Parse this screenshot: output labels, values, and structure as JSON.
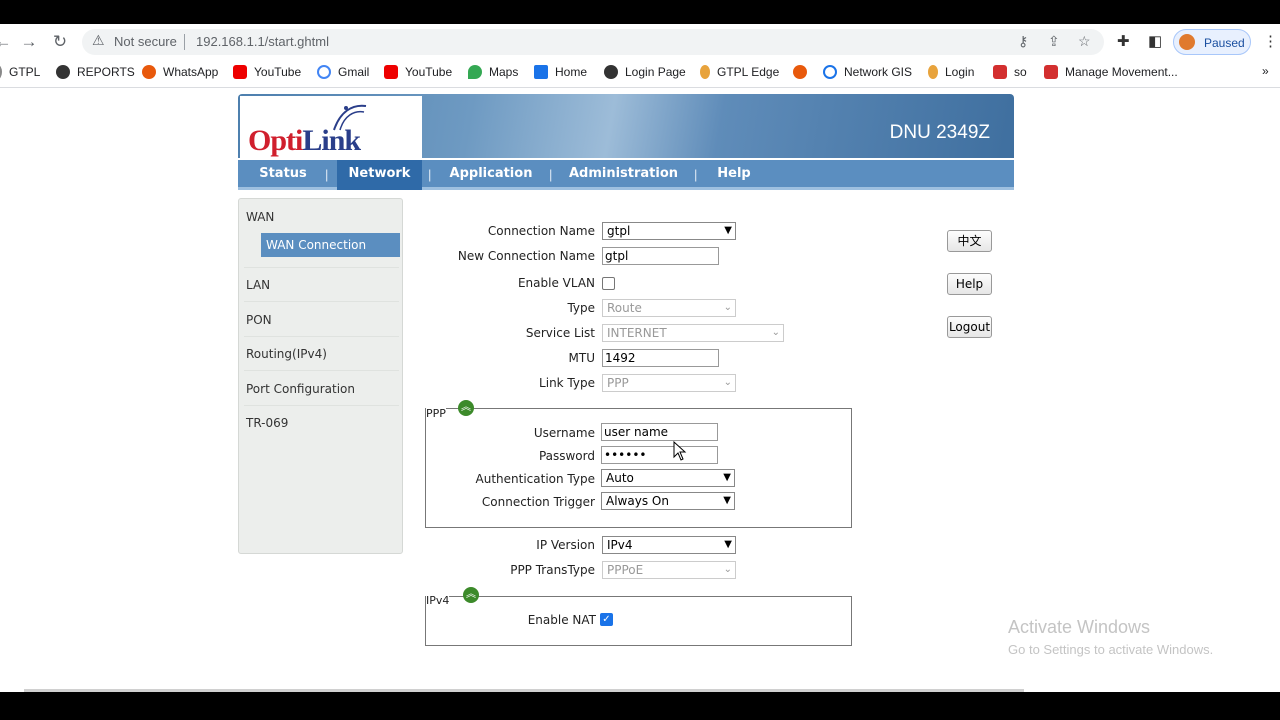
{
  "browser": {
    "security": "Not secure",
    "url": "192.168.1.1/start.ghtml",
    "profile_status": "Paused",
    "bookmarks": [
      "GTPL",
      "REPORTS",
      "WhatsApp",
      "YouTube",
      "Gmail",
      "YouTube",
      "Maps",
      "Home",
      "Login Page",
      "GTPL Edge",
      "",
      "Network GIS",
      "Login",
      "so",
      "Manage Movement..."
    ]
  },
  "router": {
    "model": "DNU 2349Z",
    "logo": "OptiLink",
    "menu": [
      "Status",
      "Network",
      "Application",
      "Administration",
      "Help"
    ],
    "sidebar": {
      "wan": "WAN",
      "wan_connection": "WAN Connection",
      "items": [
        "LAN",
        "PON",
        "Routing(IPv4)",
        "Port Configuration",
        "TR-069"
      ]
    },
    "form": {
      "connection_name_label": "Connection Name",
      "connection_name": "gtpl",
      "new_connection_name_label": "New Connection Name",
      "new_connection_name": "gtpl",
      "enable_vlan_label": "Enable VLAN",
      "type_label": "Type",
      "type": "Route",
      "service_list_label": "Service List",
      "service_list": "INTERNET",
      "mtu_label": "MTU",
      "mtu": "1492",
      "link_type_label": "Link Type",
      "link_type": "PPP",
      "ppp_legend": "PPP",
      "username_label": "Username",
      "username": "user name",
      "password_label": "Password",
      "password": "••••••",
      "auth_type_label": "Authentication Type",
      "auth_type": "Auto",
      "conn_trigger_label": "Connection Trigger",
      "conn_trigger": "Always On",
      "ip_version_label": "IP Version",
      "ip_version": "IPv4",
      "ppp_transtype_label": "PPP TransType",
      "ppp_transtype": "PPPoE",
      "ipv4_legend": "IPv4",
      "enable_nat_label": "Enable NAT"
    },
    "buttons": {
      "lang": "中文",
      "help": "Help",
      "logout": "Logout"
    }
  },
  "watermark": {
    "line1": "Activate Windows",
    "line2": "Go to Settings to activate Windows."
  }
}
